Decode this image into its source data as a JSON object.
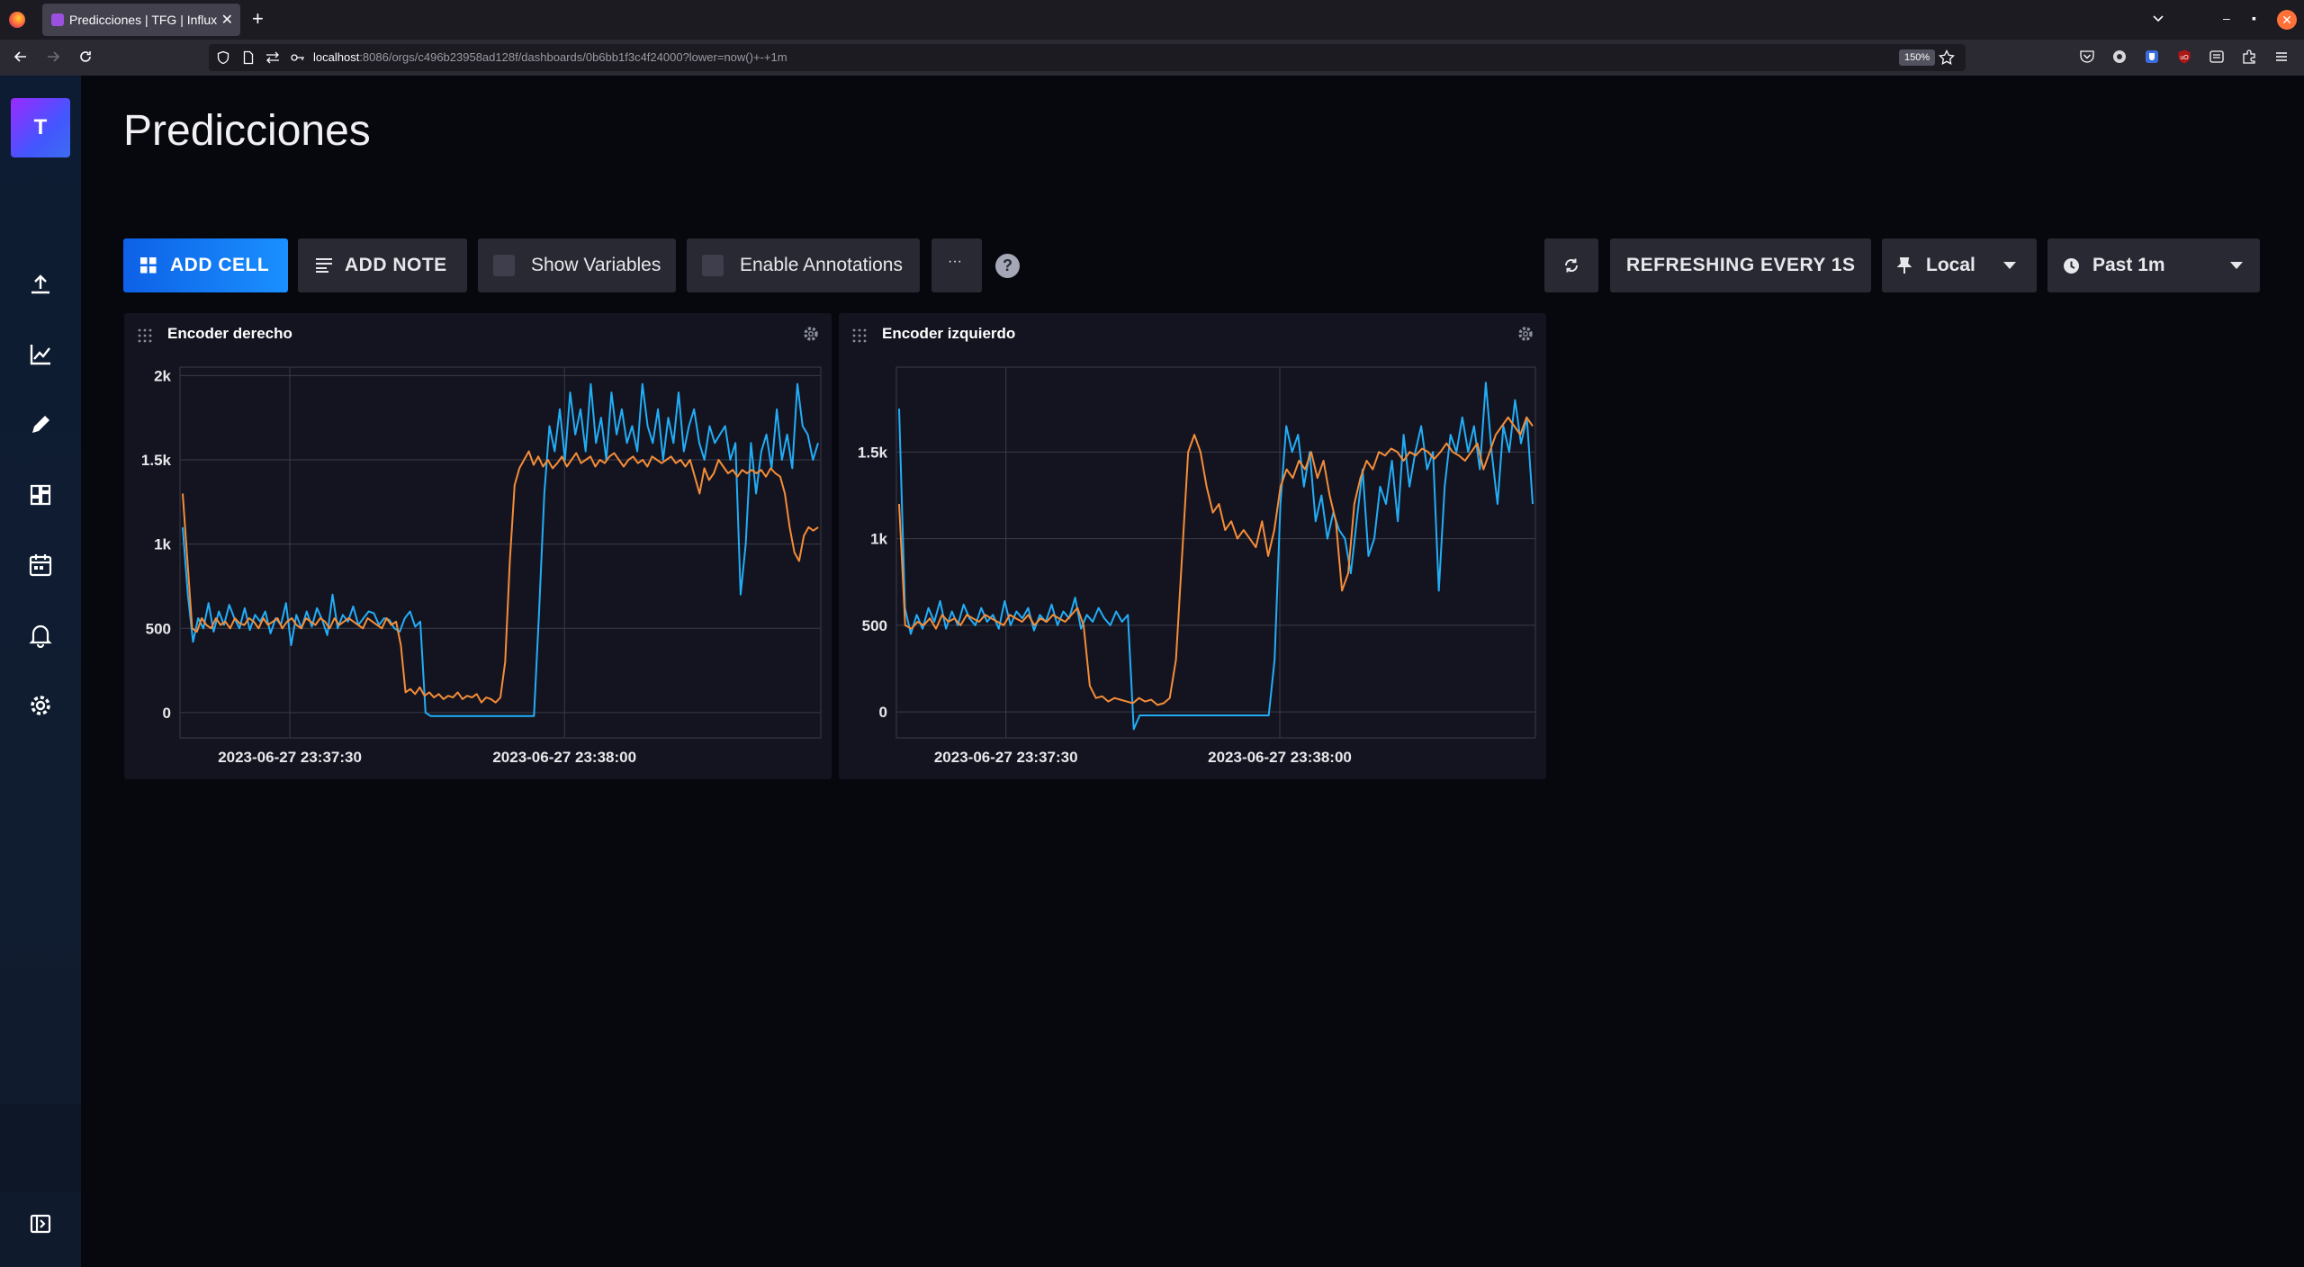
{
  "browser": {
    "tab_title": "Predicciones | TFG | InfluxDB",
    "url_host": "localhost",
    "url_path": ":8086/orgs/c496b23958ad128f/dashboards/0b6bb1f3c4f24000?lower=now()+-+1m",
    "zoom": "150%"
  },
  "sidebar": {
    "org_initial": "T",
    "items": [
      "upload-icon",
      "graph-icon",
      "pencil-icon",
      "dashboards-icon",
      "calendar-icon",
      "bell-icon",
      "settings-icon",
      "help-icon",
      "collapse-icon"
    ]
  },
  "page": {
    "title": "Predicciones"
  },
  "toolbar": {
    "add_cell": "ADD CELL",
    "add_note": "ADD NOTE",
    "show_variables": "Show Variables",
    "enable_annotations": "Enable Annotations",
    "more": "···",
    "help": "?",
    "refresh_interval": "REFRESHING EVERY 1S",
    "timezone": "Local",
    "time_range": "Past 1m"
  },
  "colors": {
    "series_a": "#22adf6",
    "series_b": "#f48d38",
    "accent": "#1a90ff"
  },
  "cells": [
    {
      "title": "Encoder derecho"
    },
    {
      "title": "Encoder izquierdo"
    }
  ],
  "chart_data": [
    {
      "type": "line",
      "title": "Encoder derecho",
      "yticks": [
        "0",
        "500",
        "1k",
        "1.5k",
        "2k"
      ],
      "xticks": [
        "2023-06-27 23:37:30",
        "2023-06-27 23:38:00"
      ],
      "x_unit": "seconds (relative)",
      "ylim": [
        -150,
        2050
      ],
      "xlim": [
        -12,
        58
      ],
      "grid": true,
      "x": [
        0,
        0.5,
        1,
        1.5,
        2,
        2.5,
        3,
        3.5,
        4,
        4.5,
        5,
        5.5,
        6,
        6.5,
        7,
        7.5,
        8,
        8.5,
        9,
        9.5,
        10,
        10.5,
        11,
        11.5,
        12,
        12.5,
        13,
        13.5,
        14,
        14.5,
        15,
        15.5,
        16,
        16.5,
        17,
        17.5,
        18,
        18.5,
        19,
        19.5,
        20,
        20.5,
        21,
        21.5,
        22,
        22.5,
        23,
        23.5,
        24,
        24.5,
        25,
        25.5,
        26,
        26.5,
        27,
        27.5,
        28,
        28.5,
        29,
        29.5,
        30,
        30.5,
        31,
        31.5,
        32,
        32.5,
        33,
        33.5,
        34,
        34.5,
        35,
        35.5,
        36,
        36.5,
        37,
        37.5,
        38,
        38.5,
        39,
        39.5,
        40,
        40.5,
        41,
        41.5,
        42,
        42.5,
        43,
        43.5,
        44,
        44.5,
        45,
        45.5,
        46,
        46.5,
        47,
        47.5,
        48,
        48.5,
        49,
        49.5,
        50,
        50.5,
        51,
        51.5,
        52,
        52.5,
        53,
        53.5,
        54,
        54.5,
        55,
        55.5,
        56,
        56.5,
        57,
        57.5,
        58,
        58.5,
        59,
        59.5,
        60,
        60.5,
        61,
        61.5,
        62,
        62.5,
        63,
        63.5,
        64,
        64.5,
        65,
        65.5,
        66,
        66.5,
        67,
        67.5,
        68,
        68.5,
        69,
        69.5,
        70
      ],
      "series": [
        {
          "values": [
            1100,
            700,
            420,
            560,
            500,
            650,
            480,
            600,
            520,
            640,
            560,
            500,
            620,
            490,
            580,
            540,
            600,
            470,
            560,
            520,
            650,
            400,
            580,
            500,
            600,
            510,
            620,
            550,
            460,
            700,
            500,
            580,
            540,
            630,
            520,
            560,
            600,
            590,
            520,
            560,
            550,
            500,
            480,
            560,
            600,
            510,
            540,
            0,
            -20,
            -20,
            -20,
            -20,
            -20,
            -20,
            -20,
            -20,
            -20,
            -20,
            -20,
            -20,
            -20,
            -20,
            -20,
            -20,
            -20,
            -20,
            -20,
            -20,
            -20,
            600,
            1300,
            1700,
            1550,
            1800,
            1500,
            1900,
            1650,
            1800,
            1550,
            1950,
            1600,
            1750,
            1500,
            1900,
            1650,
            1800,
            1600,
            1700,
            1550,
            1950,
            1700,
            1600,
            1800,
            1500,
            1750,
            1600,
            1900,
            1550,
            1700,
            1800,
            1600,
            1500,
            1700,
            1600,
            1650,
            1700,
            1500,
            1600,
            700,
            1000,
            1600,
            1300,
            1550,
            1650,
            1450,
            1800,
            1500,
            1650,
            1450,
            1950,
            1700,
            1650,
            1500,
            1600
          ],
          "color": "#22adf6"
        },
        {
          "values": [
            1300,
            900,
            500,
            480,
            560,
            520,
            500,
            560,
            520,
            540,
            500,
            560,
            530,
            520,
            560,
            540,
            500,
            560,
            520,
            540,
            560,
            500,
            540,
            560,
            520,
            500,
            560,
            540,
            520,
            560,
            540,
            500,
            560,
            520,
            540,
            560,
            540,
            520,
            500,
            560,
            540,
            520,
            500,
            560,
            520,
            540,
            400,
            120,
            140,
            110,
            150,
            100,
            120,
            90,
            110,
            80,
            100,
            90,
            120,
            80,
            100,
            90,
            110,
            60,
            90,
            80,
            60,
            90,
            300,
            900,
            1350,
            1450,
            1500,
            1550,
            1470,
            1520,
            1460,
            1500,
            1450,
            1480,
            1520,
            1460,
            1500,
            1540,
            1480,
            1500,
            1520,
            1460,
            1500,
            1480,
            1520,
            1540,
            1500,
            1460,
            1500,
            1520,
            1480,
            1500,
            1460,
            1520,
            1500,
            1480,
            1500,
            1520,
            1480,
            1500,
            1460,
            1500,
            1400,
            1300,
            1450,
            1380,
            1420,
            1500,
            1460,
            1420,
            1440,
            1400,
            1440,
            1420,
            1440,
            1420,
            1440,
            1400,
            1450,
            1420,
            1400,
            1300,
            1100,
            950,
            900,
            1050,
            1100,
            1080,
            1100
          ],
          "color": "#f48d38"
        }
      ]
    },
    {
      "type": "line",
      "title": "Encoder izquierdo",
      "yticks": [
        "0",
        "500",
        "1k",
        "1.5k"
      ],
      "xticks": [
        "2023-06-27 23:37:30",
        "2023-06-27 23:38:00"
      ],
      "x_unit": "seconds (relative)",
      "ylim": [
        -150,
        1990
      ],
      "xlim": [
        -12,
        58
      ],
      "grid": true,
      "x": [
        0,
        0.5,
        1,
        1.5,
        2,
        2.5,
        3,
        3.5,
        4,
        4.5,
        5,
        5.5,
        6,
        6.5,
        7,
        7.5,
        8,
        8.5,
        9,
        9.5,
        10,
        10.5,
        11,
        11.5,
        12,
        12.5,
        13,
        13.5,
        14,
        14.5,
        15,
        15.5,
        16,
        16.5,
        17,
        17.5,
        18,
        18.5,
        19,
        19.5,
        20,
        20.5,
        21,
        21.5,
        22,
        22.5,
        23,
        23.5,
        24,
        24.5,
        25,
        25.5,
        26,
        26.5,
        27,
        27.5,
        28,
        28.5,
        29,
        29.5,
        30,
        30.5,
        31,
        31.5,
        32,
        32.5,
        33,
        33.5,
        34,
        34.5,
        35,
        35.5,
        36,
        36.5,
        37,
        37.5,
        38,
        38.5,
        39,
        39.5,
        40,
        40.5,
        41,
        41.5,
        42,
        42.5,
        43,
        43.5,
        44,
        44.5,
        45,
        45.5,
        46,
        46.5,
        47,
        47.5,
        48,
        48.5,
        49,
        49.5,
        50,
        50.5,
        51,
        51.5,
        52,
        52.5,
        53,
        53.5,
        54,
        54.5,
        55,
        55.5,
        56,
        56.5,
        57,
        57.5,
        58,
        58.5,
        59,
        59.5,
        60,
        60.5,
        61,
        61.5,
        62,
        62.5,
        63,
        63.5,
        64,
        64.5,
        65,
        65.5,
        66,
        66.5,
        67,
        67.5,
        68,
        68.5,
        69,
        69.5,
        70
      ],
      "series": [
        {
          "values": [
            1750,
            600,
            450,
            560,
            480,
            600,
            520,
            640,
            480,
            580,
            500,
            620,
            540,
            500,
            600,
            520,
            560,
            480,
            640,
            500,
            580,
            540,
            600,
            470,
            560,
            520,
            620,
            500,
            580,
            540,
            660,
            480,
            560,
            520,
            600,
            540,
            500,
            580,
            520,
            560,
            -100,
            -20,
            -20,
            -20,
            -20,
            -20,
            -20,
            -20,
            -20,
            -20,
            -20,
            -20,
            -20,
            -20,
            -20,
            -20,
            -20,
            -20,
            -20,
            -20,
            -20,
            -20,
            -20,
            -20,
            300,
            1200,
            1650,
            1500,
            1600,
            1300,
            1500,
            1100,
            1250,
            1000,
            1150,
            1050,
            1000,
            800,
            1100,
            1400,
            900,
            1000,
            1300,
            1200,
            1450,
            1100,
            1600,
            1300,
            1500,
            1650,
            1400,
            1500,
            700,
            1300,
            1600,
            1500,
            1700,
            1500,
            1650,
            1400,
            1900,
            1500,
            1200,
            1650,
            1500,
            1800,
            1550,
            1700,
            1200
          ],
          "color": "#22adf6"
        },
        {
          "values": [
            1200,
            500,
            480,
            520,
            500,
            540,
            480,
            560,
            520,
            540,
            500,
            560,
            540,
            520,
            560,
            540,
            520,
            500,
            560,
            540,
            520,
            560,
            500,
            540,
            520,
            560,
            540,
            520,
            560,
            600,
            500,
            150,
            80,
            90,
            60,
            80,
            70,
            60,
            50,
            80,
            60,
            70,
            40,
            50,
            80,
            300,
            900,
            1500,
            1600,
            1500,
            1300,
            1150,
            1200,
            1050,
            1100,
            1000,
            1050,
            1000,
            950,
            1100,
            900,
            1050,
            1300,
            1400,
            1350,
            1450,
            1400,
            1500,
            1350,
            1450,
            1250,
            1100,
            700,
            800,
            1200,
            1350,
            1450,
            1400,
            1500,
            1480,
            1520,
            1500,
            1450,
            1500,
            1480,
            1520,
            1500,
            1460,
            1500,
            1550,
            1500,
            1480,
            1450,
            1500,
            1550,
            1400,
            1500,
            1600,
            1650,
            1700,
            1650,
            1600,
            1700,
            1650
          ],
          "color": "#f48d38"
        }
      ]
    }
  ]
}
